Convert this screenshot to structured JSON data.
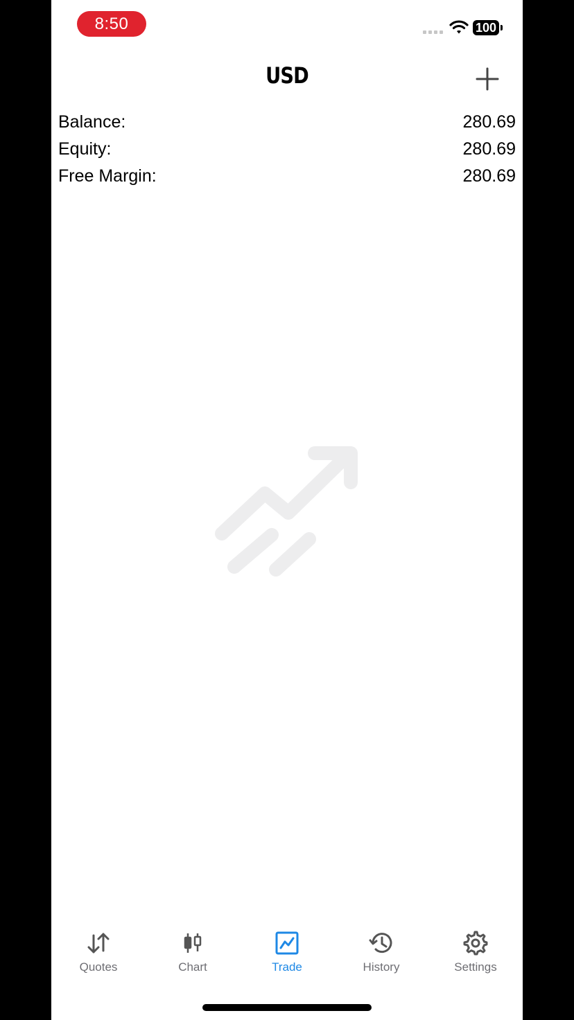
{
  "status_bar": {
    "time": "8:50",
    "battery": "100"
  },
  "header": {
    "title": "USD"
  },
  "account": {
    "rows": [
      {
        "label": "Balance:",
        "value": "280.69"
      },
      {
        "label": "Equity:",
        "value": "280.69"
      },
      {
        "label": "Free Margin:",
        "value": "280.69"
      }
    ]
  },
  "empty_state": {
    "icon": "trade-chart-arrow-icon"
  },
  "tabbar": {
    "active": "Trade",
    "accent_color": "#1e88e5",
    "items": [
      {
        "label": "Quotes",
        "icon": "quotes-arrows-icon"
      },
      {
        "label": "Chart",
        "icon": "candlestick-icon"
      },
      {
        "label": "Trade",
        "icon": "trade-chart-icon"
      },
      {
        "label": "History",
        "icon": "history-clock-icon"
      },
      {
        "label": "Settings",
        "icon": "gear-icon"
      }
    ]
  }
}
